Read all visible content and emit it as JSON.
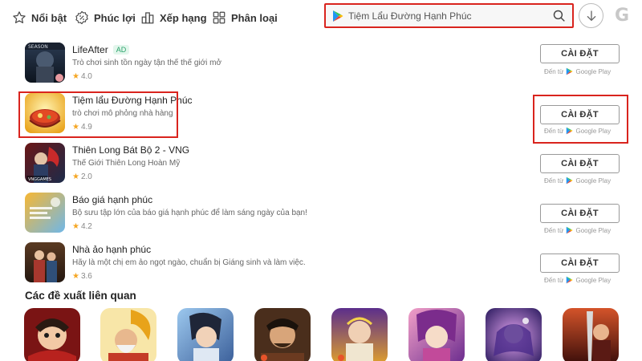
{
  "nav": {
    "items": [
      {
        "label": "Nổi bật",
        "icon": "star-icon"
      },
      {
        "label": "Phúc lợi",
        "icon": "percent-badge-icon"
      },
      {
        "label": "Xếp hạng",
        "icon": "ranking-icon"
      },
      {
        "label": "Phân loại",
        "icon": "grid-icon"
      }
    ]
  },
  "search": {
    "value": "Tiệm Lẩu Đường Hạnh Phúc",
    "placeholder": "Tiệm Lẩu Đường Hạnh Phúc"
  },
  "apps": [
    {
      "name": "LifeAfter",
      "ad": "AD",
      "desc": "Trò chơi sinh tồn ngày tận thế thế giới mở",
      "rating": "4.0",
      "install": "CÀI ĐẶT",
      "store_prefix": "Đến từ",
      "store_name": "Google Play"
    },
    {
      "name": "Tiệm lẩu Đường Hạnh Phúc",
      "desc": "trò chơi mô phỏng nhà hàng",
      "rating": "4.9",
      "install": "CÀI ĐẶT",
      "store_prefix": "Đến từ",
      "store_name": "Google Play"
    },
    {
      "name": "Thiên Long Bát Bộ 2 - VNG",
      "desc": "Thế Giới Thiên Long Hoàn Mỹ",
      "rating": "2.0",
      "install": "CÀI ĐẶT",
      "store_prefix": "Đến từ",
      "store_name": "Google Play"
    },
    {
      "name": "Báo giá hạnh phúc",
      "desc": "Bộ sưu tập lớn của báo giá hạnh phúc để làm sáng ngày của bạn!",
      "rating": "4.2",
      "install": "CÀI ĐẶT",
      "store_prefix": "Đến từ",
      "store_name": "Google Play"
    },
    {
      "name": "Nhà ảo hạnh phúc",
      "desc": "Hãy là một chị em ảo ngọt ngào, chuẩn bị Giáng sinh và làm việc.",
      "rating": "3.6",
      "install": "CÀI ĐẶT",
      "store_prefix": "Đến từ",
      "store_name": "Google Play"
    }
  ],
  "related": {
    "title": "Các đề xuất liên quan"
  },
  "colors": {
    "highlight": "#d9241e",
    "star": "#f5a623",
    "ad_badge": "#2aa36b"
  }
}
